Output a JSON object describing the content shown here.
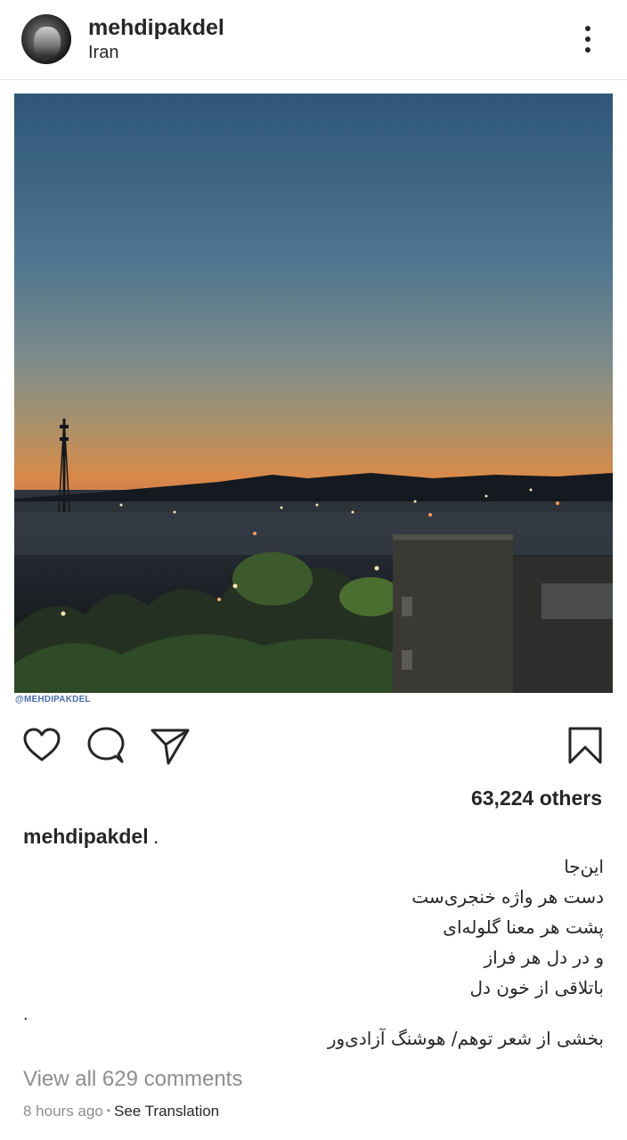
{
  "header": {
    "username": "mehdipakdel",
    "location": "Iran"
  },
  "post": {
    "watermark": "@MEHDIPAKDEL"
  },
  "actions": {
    "like_icon": "heart-icon",
    "comment_icon": "comment-icon",
    "share_icon": "send-icon",
    "save_icon": "bookmark-icon"
  },
  "likes": {
    "text": "63,224 others"
  },
  "caption": {
    "username": "mehdipakdel",
    "trailing": ".",
    "poem_lines": [
      "این‌جا",
      "دست هر واژه خنجری‌ست",
      "پشت هر معنا گلوله‌ای",
      "و در دل هر فراز",
      "باتلاقی از خون دل"
    ],
    "separator": ".",
    "credit": "بخشی از شعر توهم/ هوشنگ آزادی‌ور"
  },
  "comments": {
    "view_all": "View all 629 comments"
  },
  "meta": {
    "time": "8 hours ago",
    "separator": "•",
    "translate": "See Translation"
  }
}
